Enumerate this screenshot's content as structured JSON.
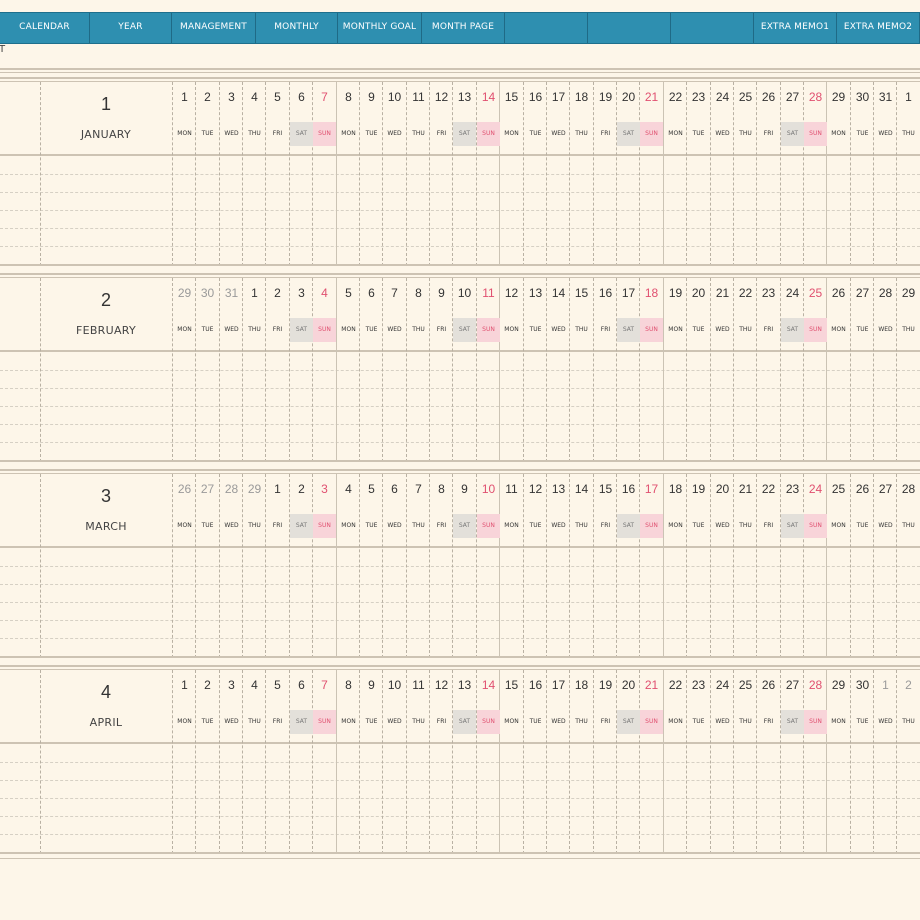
{
  "nav": {
    "tabs": [
      "CALENDAR",
      "YEAR",
      "MANAGEMENT",
      "MONTHLY",
      "MONTHLY GOAL",
      "MONTH PAGE",
      "",
      "",
      "",
      "EXTRA MEMO1",
      "EXTRA MEMO2"
    ]
  },
  "page_label": "T",
  "weekday_labels": [
    "MON",
    "TUE",
    "WED",
    "THU",
    "FRI",
    "SAT",
    "SUN"
  ],
  "months": [
    {
      "number": "1",
      "name": "JANUARY",
      "days": [
        {
          "d": "1",
          "c": "n"
        },
        {
          "d": "2",
          "c": "n"
        },
        {
          "d": "3",
          "c": "n"
        },
        {
          "d": "4",
          "c": "n"
        },
        {
          "d": "5",
          "c": "n"
        },
        {
          "d": "6",
          "c": "n"
        },
        {
          "d": "7",
          "c": "r"
        },
        {
          "d": "8",
          "c": "n"
        },
        {
          "d": "9",
          "c": "n"
        },
        {
          "d": "10",
          "c": "n"
        },
        {
          "d": "11",
          "c": "n"
        },
        {
          "d": "12",
          "c": "n"
        },
        {
          "d": "13",
          "c": "n"
        },
        {
          "d": "14",
          "c": "r"
        },
        {
          "d": "15",
          "c": "n"
        },
        {
          "d": "16",
          "c": "n"
        },
        {
          "d": "17",
          "c": "n"
        },
        {
          "d": "18",
          "c": "n"
        },
        {
          "d": "19",
          "c": "n"
        },
        {
          "d": "20",
          "c": "n"
        },
        {
          "d": "21",
          "c": "r"
        },
        {
          "d": "22",
          "c": "n"
        },
        {
          "d": "23",
          "c": "n"
        },
        {
          "d": "24",
          "c": "n"
        },
        {
          "d": "25",
          "c": "n"
        },
        {
          "d": "26",
          "c": "n"
        },
        {
          "d": "27",
          "c": "n"
        },
        {
          "d": "28",
          "c": "r"
        },
        {
          "d": "29",
          "c": "n"
        },
        {
          "d": "30",
          "c": "n"
        },
        {
          "d": "31",
          "c": "n"
        },
        {
          "d": "1",
          "c": "n"
        }
      ]
    },
    {
      "number": "2",
      "name": "FEBRUARY",
      "days": [
        {
          "d": "29",
          "c": "g"
        },
        {
          "d": "30",
          "c": "g"
        },
        {
          "d": "31",
          "c": "g"
        },
        {
          "d": "1",
          "c": "n"
        },
        {
          "d": "2",
          "c": "n"
        },
        {
          "d": "3",
          "c": "n"
        },
        {
          "d": "4",
          "c": "r"
        },
        {
          "d": "5",
          "c": "n"
        },
        {
          "d": "6",
          "c": "n"
        },
        {
          "d": "7",
          "c": "n"
        },
        {
          "d": "8",
          "c": "n"
        },
        {
          "d": "9",
          "c": "n"
        },
        {
          "d": "10",
          "c": "n"
        },
        {
          "d": "11",
          "c": "r"
        },
        {
          "d": "12",
          "c": "n"
        },
        {
          "d": "13",
          "c": "n"
        },
        {
          "d": "14",
          "c": "n"
        },
        {
          "d": "15",
          "c": "n"
        },
        {
          "d": "16",
          "c": "n"
        },
        {
          "d": "17",
          "c": "n"
        },
        {
          "d": "18",
          "c": "r"
        },
        {
          "d": "19",
          "c": "n"
        },
        {
          "d": "20",
          "c": "n"
        },
        {
          "d": "21",
          "c": "n"
        },
        {
          "d": "22",
          "c": "n"
        },
        {
          "d": "23",
          "c": "n"
        },
        {
          "d": "24",
          "c": "n"
        },
        {
          "d": "25",
          "c": "r"
        },
        {
          "d": "26",
          "c": "n"
        },
        {
          "d": "27",
          "c": "n"
        },
        {
          "d": "28",
          "c": "n"
        },
        {
          "d": "29",
          "c": "n"
        }
      ]
    },
    {
      "number": "3",
      "name": "MARCH",
      "days": [
        {
          "d": "26",
          "c": "g"
        },
        {
          "d": "27",
          "c": "g"
        },
        {
          "d": "28",
          "c": "g"
        },
        {
          "d": "29",
          "c": "g"
        },
        {
          "d": "1",
          "c": "n"
        },
        {
          "d": "2",
          "c": "n"
        },
        {
          "d": "3",
          "c": "r"
        },
        {
          "d": "4",
          "c": "n"
        },
        {
          "d": "5",
          "c": "n"
        },
        {
          "d": "6",
          "c": "n"
        },
        {
          "d": "7",
          "c": "n"
        },
        {
          "d": "8",
          "c": "n"
        },
        {
          "d": "9",
          "c": "n"
        },
        {
          "d": "10",
          "c": "r"
        },
        {
          "d": "11",
          "c": "n"
        },
        {
          "d": "12",
          "c": "n"
        },
        {
          "d": "13",
          "c": "n"
        },
        {
          "d": "14",
          "c": "n"
        },
        {
          "d": "15",
          "c": "n"
        },
        {
          "d": "16",
          "c": "n"
        },
        {
          "d": "17",
          "c": "r"
        },
        {
          "d": "18",
          "c": "n"
        },
        {
          "d": "19",
          "c": "n"
        },
        {
          "d": "20",
          "c": "n"
        },
        {
          "d": "21",
          "c": "n"
        },
        {
          "d": "22",
          "c": "n"
        },
        {
          "d": "23",
          "c": "n"
        },
        {
          "d": "24",
          "c": "r"
        },
        {
          "d": "25",
          "c": "n"
        },
        {
          "d": "26",
          "c": "n"
        },
        {
          "d": "27",
          "c": "n"
        },
        {
          "d": "28",
          "c": "n"
        }
      ]
    },
    {
      "number": "4",
      "name": "APRIL",
      "days": [
        {
          "d": "1",
          "c": "n"
        },
        {
          "d": "2",
          "c": "n"
        },
        {
          "d": "3",
          "c": "n"
        },
        {
          "d": "4",
          "c": "n"
        },
        {
          "d": "5",
          "c": "n"
        },
        {
          "d": "6",
          "c": "n"
        },
        {
          "d": "7",
          "c": "r"
        },
        {
          "d": "8",
          "c": "n"
        },
        {
          "d": "9",
          "c": "n"
        },
        {
          "d": "10",
          "c": "n"
        },
        {
          "d": "11",
          "c": "n"
        },
        {
          "d": "12",
          "c": "n"
        },
        {
          "d": "13",
          "c": "n"
        },
        {
          "d": "14",
          "c": "r"
        },
        {
          "d": "15",
          "c": "n"
        },
        {
          "d": "16",
          "c": "n"
        },
        {
          "d": "17",
          "c": "n"
        },
        {
          "d": "18",
          "c": "n"
        },
        {
          "d": "19",
          "c": "n"
        },
        {
          "d": "20",
          "c": "n"
        },
        {
          "d": "21",
          "c": "r"
        },
        {
          "d": "22",
          "c": "n"
        },
        {
          "d": "23",
          "c": "n"
        },
        {
          "d": "24",
          "c": "n"
        },
        {
          "d": "25",
          "c": "n"
        },
        {
          "d": "26",
          "c": "n"
        },
        {
          "d": "27",
          "c": "n"
        },
        {
          "d": "28",
          "c": "r"
        },
        {
          "d": "29",
          "c": "n"
        },
        {
          "d": "30",
          "c": "n"
        },
        {
          "d": "1",
          "c": "g"
        },
        {
          "d": "2",
          "c": "g"
        }
      ]
    }
  ],
  "colors": {
    "nav_bg": "#2e8fb0",
    "page_bg": "#fdf6e9",
    "sunday_text": "#e05070",
    "sunday_cell": "#f8d4d9",
    "saturday_cell": "#e3e0da",
    "outside_day_text": "#9a9a9a"
  }
}
